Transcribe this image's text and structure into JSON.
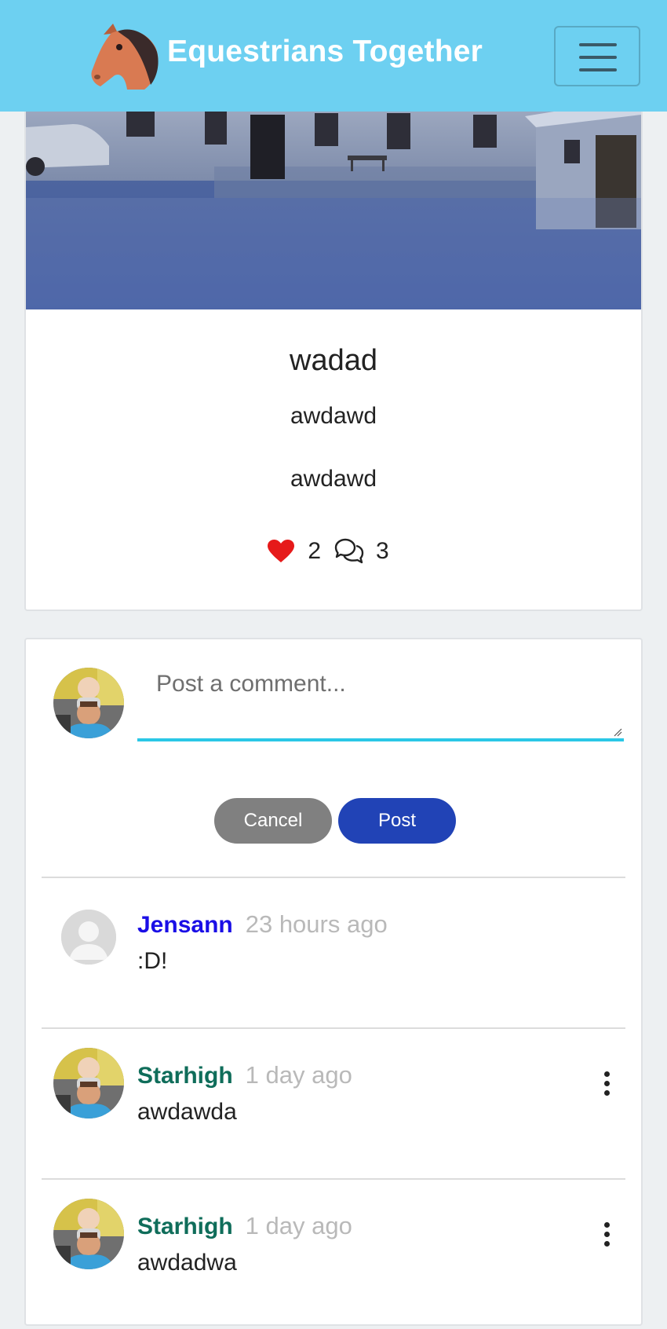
{
  "navbar": {
    "brand_title": "Equestrians Together",
    "brand_logo_icon": "horse-head-icon",
    "menu_icon": "hamburger-menu-icon",
    "background_color": "#6dd0f1"
  },
  "post": {
    "title": "wadad",
    "content_lines": [
      "awdawd",
      "awdawd"
    ],
    "likes_count": "2",
    "comments_count": "3",
    "like_icon": "heart-icon",
    "comments_icon": "comments-icon",
    "like_color": "#e61a1a"
  },
  "comment_form": {
    "placeholder": "Post a comment...",
    "value": "",
    "cancel_label": "Cancel",
    "post_label": "Post",
    "accent_color": "#2ac7e6",
    "post_button_color": "#2143b6"
  },
  "comments": [
    {
      "author": "Jensann",
      "time": "23 hours ago",
      "text": ":D!",
      "author_color": "#1a0ee6",
      "avatar": "default-avatar",
      "has_menu": false
    },
    {
      "author": "Starhigh",
      "time": "1 day ago",
      "text": "awdawda",
      "author_color": "#0f6d5a",
      "avatar": "user-photo-avatar",
      "has_menu": true
    },
    {
      "author": "Starhigh",
      "time": "1 day ago",
      "text": "awdadwa",
      "author_color": "#0f6d5a",
      "avatar": "user-photo-avatar",
      "has_menu": true
    }
  ]
}
